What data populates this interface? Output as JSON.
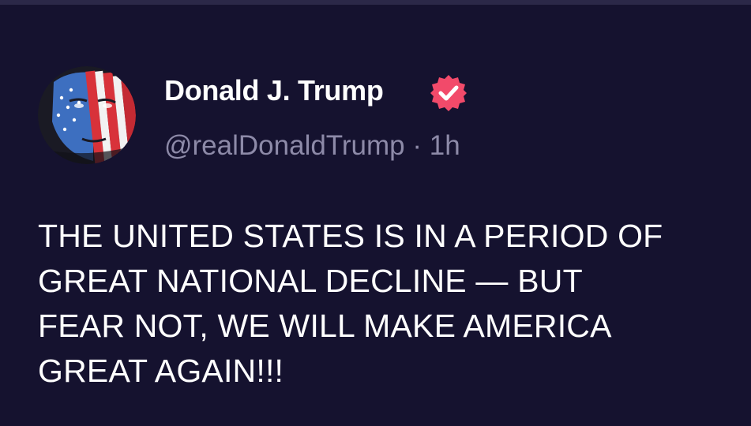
{
  "post": {
    "author": {
      "display_name": "Donald J. Trump",
      "handle": "@realDonaldTrump",
      "verified_icon": "verified-badge-icon",
      "verified_color": "#f24a6a",
      "avatar_icon": "avatar-flag-portrait"
    },
    "separator": " · ",
    "time_ago": "1h",
    "text": "THE UNITED STATES IS IN A PERIOD OF\nGREAT NATIONAL DECLINE — BUT\nFEAR NOT, WE WILL MAKE AMERICA\nGREAT AGAIN!!!"
  },
  "theme": {
    "background": "#15122f",
    "text": "#ffffff",
    "muted_text": "#8d8aa8"
  }
}
